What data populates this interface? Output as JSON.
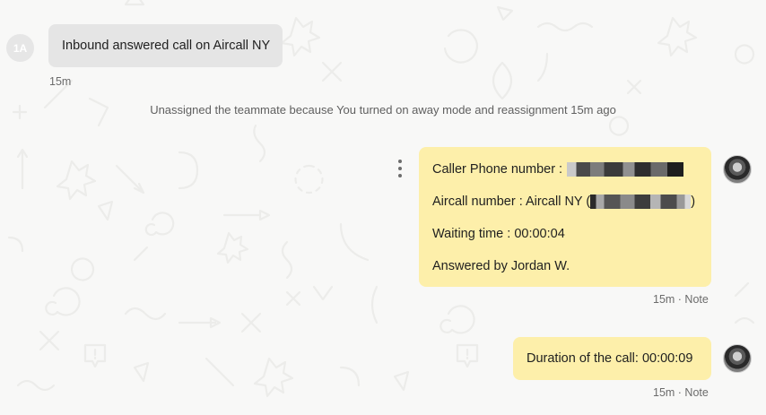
{
  "conversation": {
    "messages": [
      {
        "avatar_initials": "1A",
        "text": "Inbound answered call on Aircall NY",
        "time": "15m"
      }
    ],
    "system_event": "Unassigned the teammate because You turned on away mode and reassignment 15m ago",
    "notes": [
      {
        "lines": [
          {
            "label": "Caller Phone number :",
            "redacted": true
          },
          {
            "label": "Aircall number : Aircall NY (",
            "redacted": true,
            "suffix": ")"
          },
          {
            "label": "Waiting time : 00:00:04"
          },
          {
            "label": "Answered by Jordan W."
          }
        ],
        "meta": "15m · Note"
      },
      {
        "lines": [
          {
            "label": "Duration of the call: 00:00:09"
          }
        ],
        "meta": "15m · Note"
      }
    ]
  },
  "icons": {
    "more_actions": "kebab-menu-icon",
    "author_avatar": "user-avatar"
  },
  "colors": {
    "background": "#f8f8f7",
    "inbound_bubble": "#e5e5e5",
    "note_bubble": "#fdefaa",
    "meta_text": "#6b6b6b"
  }
}
